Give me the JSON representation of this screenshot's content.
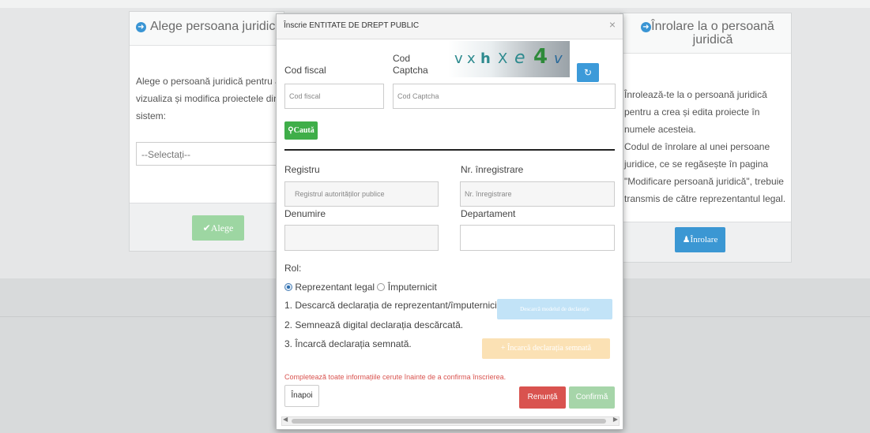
{
  "left_card": {
    "title": "Alege persoana juridică",
    "description": "Alege o persoană juridică pentru a vizualiza și modifica proiectele din sistem:",
    "select_value": "--Selectați--",
    "button_label": "Alege",
    "button_icon": "checkmark-icon"
  },
  "right_card": {
    "title": "Înrolare la o persoană juridică",
    "description_1": "Înrolează-te la o persoană juridică pentru a crea și edita proiecte în numele acesteia.",
    "description_2": "Codul de înrolare al unei persoane juridice, ce se regăsește în pagina \"Modificare persoană juridică\", trebuie transmis de către reprezentantul legal.",
    "button_label": "Înrolare",
    "button_icon": "user-icon"
  },
  "modal": {
    "title": "Înscrie ENTITATE DE DREPT PUBLIC",
    "close": "×",
    "cod_fiscal_label": "Cod fiscal",
    "cod_fiscal_placeholder": "Cod fiscal",
    "captcha_label": "Cod Captcha",
    "captcha_placeholder": "Cod Captcha",
    "captcha_chars": [
      "v",
      "x",
      "h",
      "X",
      "e",
      "4",
      "v"
    ],
    "search_button": "Caută",
    "registru_label": "Registru",
    "registru_value": "Registrul autorităților publice",
    "nr_label": "Nr. înregistrare",
    "nr_placeholder": "Nr. înregistrare",
    "denumire_label": "Denumire",
    "departament_label": "Departament",
    "rol_label": "Rol:",
    "rol_options": [
      "Reprezentant legal",
      "Împuternicit"
    ],
    "rol_selected": "Reprezentant legal",
    "step1": "1. Descarcă declarația de reprezentant/împuternicit",
    "step2": "2. Semnează digital declarația descărcată.",
    "step3": "3. Încarcă declarația semnată.",
    "download_button": "Descarcă modelul de declarație",
    "upload_button": "Încarcă declarația semnată",
    "error_text": "Completează toate informațiile cerute înainte de a confirma înscrierea.",
    "back_button": "Înapoi",
    "cancel_button": "Renunță",
    "confirm_button": "Confirmă"
  },
  "colors": {
    "primary": "#3b97d3",
    "success": "#3fae49",
    "danger": "#d9534f",
    "warning_light": "#fbe1b4"
  }
}
